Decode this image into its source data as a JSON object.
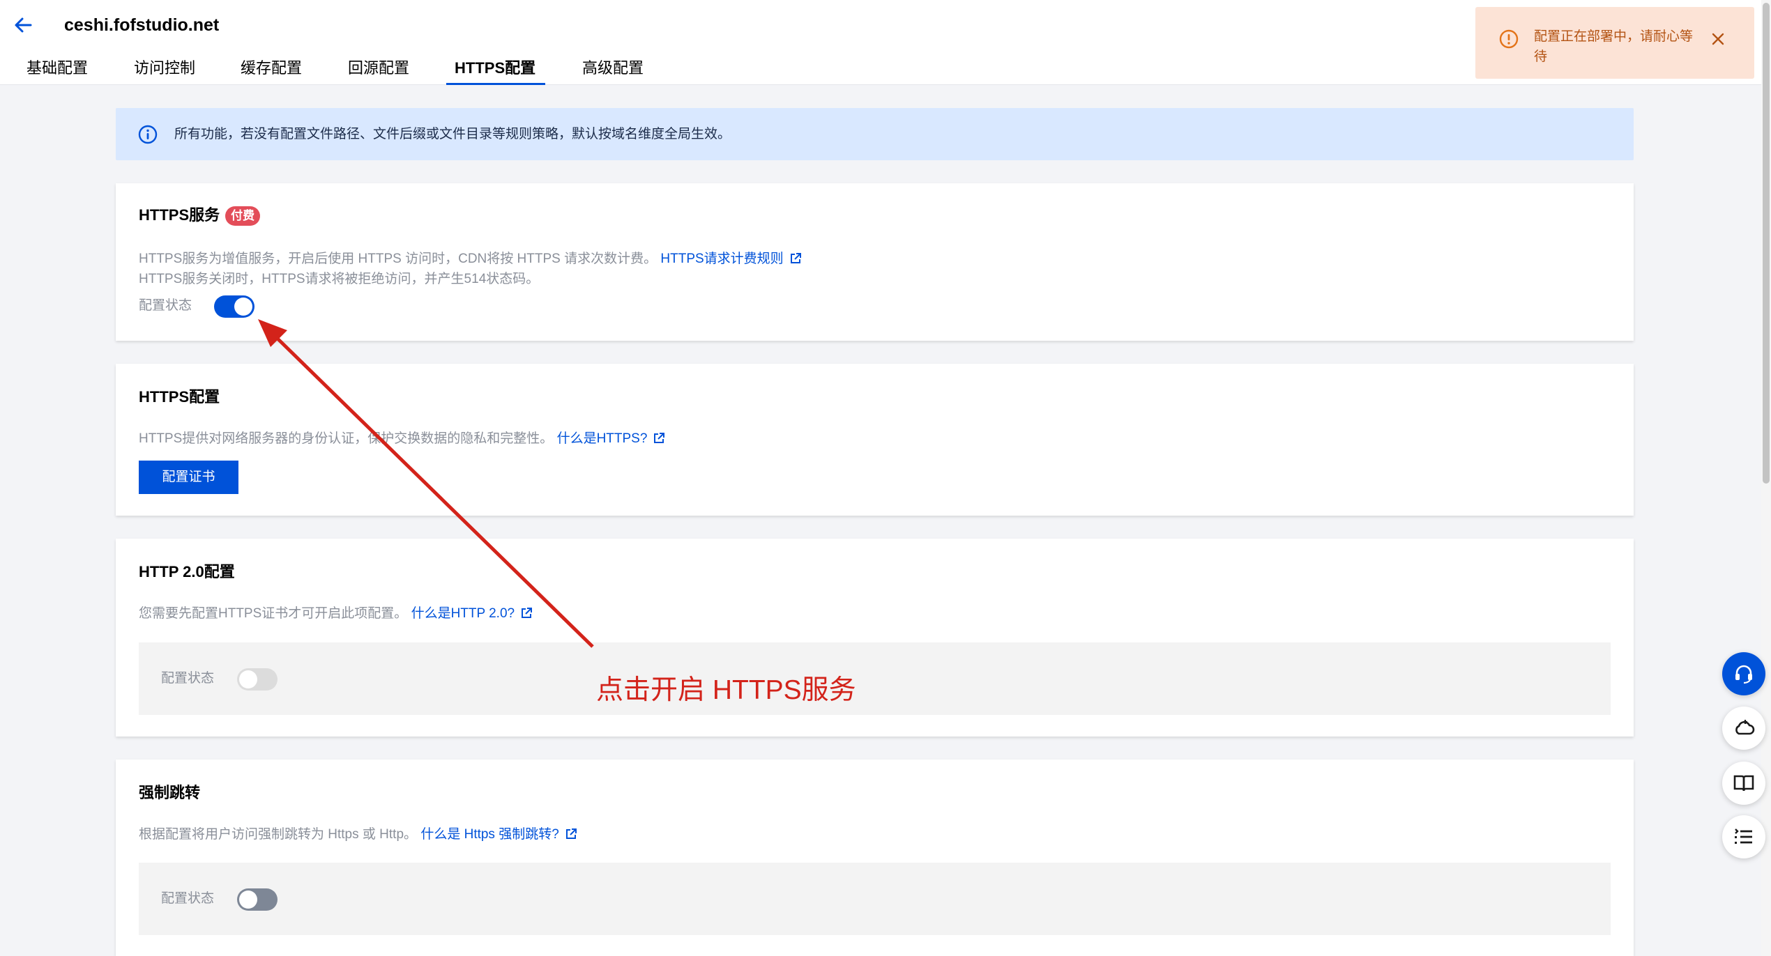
{
  "header": {
    "title": "ceshi.fofstudio.net",
    "tabs": [
      {
        "label": "基础配置"
      },
      {
        "label": "访问控制"
      },
      {
        "label": "缓存配置"
      },
      {
        "label": "回源配置"
      },
      {
        "label": "HTTPS配置",
        "active": true
      },
      {
        "label": "高级配置"
      }
    ]
  },
  "notification": {
    "text": "配置正在部署中，请耐心等待",
    "color": "#b35313"
  },
  "info_banner": {
    "text": "所有功能，若没有配置文件路径、文件后缀或文件目录等规则策略，默认按域名维度全局生效。"
  },
  "https_service": {
    "title": "HTTPS服务",
    "badge": "付费",
    "desc_line1": "HTTPS服务为增值服务，开启后使用 HTTPS 访问时，CDN将按 HTTPS 请求次数计费。",
    "desc_link": "HTTPS请求计费规则",
    "desc_line2": "HTTPS服务关闭时，HTTPS请求将被拒绝访问，并产生514状态码。",
    "status_label": "配置状态",
    "enabled": true
  },
  "https_config": {
    "title": "HTTPS配置",
    "desc": "HTTPS提供对网络服务器的身份认证，保护交换数据的隐私和完整性。",
    "desc_link": "什么是HTTPS?",
    "button": "配置证书"
  },
  "http2_config": {
    "title": "HTTP 2.0配置",
    "desc": "您需要先配置HTTPS证书才可开启此项配置。",
    "desc_link": "什么是HTTP 2.0?",
    "status_label": "配置状态",
    "enabled": false
  },
  "force_redirect": {
    "title": "强制跳转",
    "desc": "根据配置将用户访问强制跳转为 Https 或 Http。",
    "desc_link": "什么是 Https 强制跳转?",
    "status_label": "配置状态",
    "enabled": false
  },
  "annotation": {
    "text": "点击开启 HTTPS服务",
    "color": "#d3231a"
  },
  "floating_buttons": [
    {
      "icon": "headset-icon"
    },
    {
      "icon": "cloud-icon"
    },
    {
      "icon": "book-icon"
    },
    {
      "icon": "list-icon"
    }
  ],
  "colors": {
    "primary": "#0052d9",
    "badge": "#e34d59",
    "info_bg": "#d9e8ff",
    "notice_bg": "#fce3d6"
  }
}
